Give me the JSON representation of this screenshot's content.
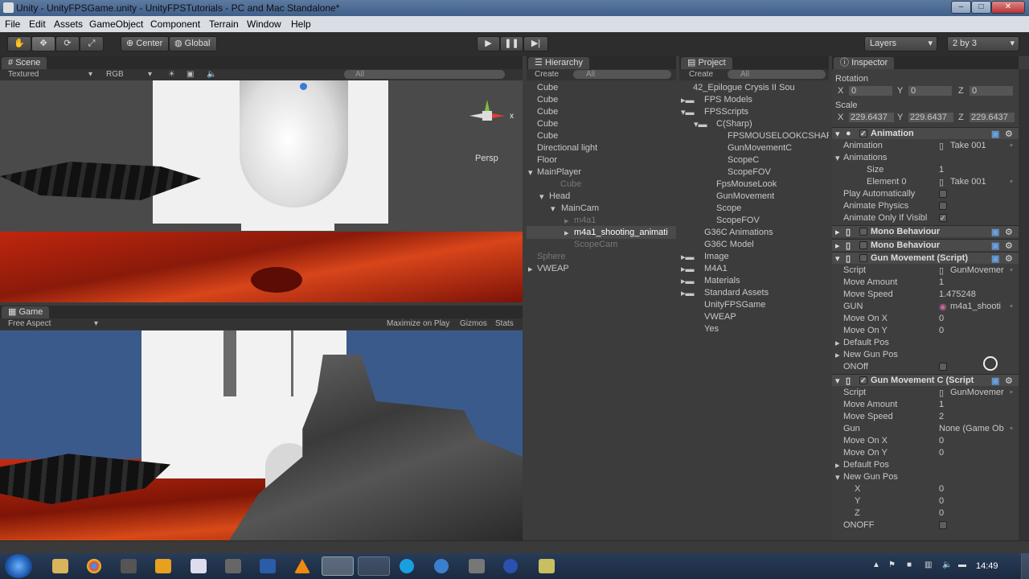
{
  "window": {
    "title": "Unity - UnityFPSGame.unity - UnityFPSTutorials - PC and Mac Standalone*"
  },
  "menu": [
    "File",
    "Edit",
    "Assets",
    "GameObject",
    "Component",
    "Terrain",
    "Window",
    "Help"
  ],
  "toolbar": {
    "center": "Center",
    "global": "Global",
    "layers": "Layers",
    "layout": "2 by 3"
  },
  "scene": {
    "tab": "Scene",
    "mode": "Textured",
    "rgb": "RGB",
    "search": "All",
    "persp": "Persp",
    "x": "x"
  },
  "game": {
    "tab": "Game",
    "aspect": "Free Aspect",
    "maximize": "Maximize on Play",
    "gizmos": "Gizmos",
    "stats": "Stats"
  },
  "hierarchy": {
    "tab": "Hierarchy",
    "create": "Create",
    "search": "All",
    "items": [
      "Cube",
      "Cube",
      "Cube",
      "Cube",
      "Cube",
      "Directional light",
      "Floor",
      "MainPlayer",
      "Cube",
      "Head",
      "MainCam",
      "m4a1",
      "m4a1_shooting_animati",
      "ScopeCam",
      "Sphere",
      "VWEAP"
    ]
  },
  "project": {
    "tab": "Project",
    "create": "Create",
    "search": "All",
    "items": [
      "42_Epilogue  Crysis II  Sou",
      "FPS Models",
      "FPSScripts",
      "C(Sharp)",
      "FPSMOUSELOOKCSHAR",
      "GunMovementC",
      "ScopeC",
      "ScopeFOV",
      "FpsMouseLook",
      "GunMovement",
      "Scope",
      "ScopeFOV",
      "G36C Animations",
      "G36C Model",
      "Image",
      "M4A1",
      "Materials",
      "Standard Assets",
      "UnityFPSGame",
      "VWEAP",
      "Yes"
    ]
  },
  "inspector": {
    "tab": "Inspector",
    "rotation_label": "Rotation",
    "rx": "0",
    "ry": "0",
    "rz": "0",
    "scale_label": "Scale",
    "sx": "229.6437",
    "sy": "229.6437",
    "sz": "229.6437",
    "axis_x": "X",
    "axis_y": "Y",
    "axis_z": "Z",
    "animation": {
      "title": "Animation",
      "anim_label": "Animation",
      "anim_val": "Take 001",
      "anims_label": "Animations",
      "size_label": "Size",
      "size_val": "1",
      "el0_label": "Element 0",
      "el0_val": "Take 001",
      "play_auto": "Play Automatically",
      "animate_physics": "Animate Physics",
      "animate_visible": "Animate Only If Visibl"
    },
    "mono1": "Mono Behaviour",
    "mono2": "Mono Behaviour",
    "gun_movement": {
      "title": "Gun Movement  (Script)",
      "script_label": "Script",
      "script_val": "GunMovemer",
      "move_amount_label": "Move Amount",
      "move_amount_val": "1",
      "move_speed_label": "Move Speed",
      "move_speed_val": "1.475248",
      "gun_label": "GUN",
      "gun_val": "m4a1_shooti",
      "move_x_label": "Move On X",
      "move_x_val": "0",
      "move_y_label": "Move On Y",
      "move_y_val": "0",
      "default_pos": "Default Pos",
      "new_gun_pos": "New Gun Pos",
      "onoff": "ONOff"
    },
    "gun_movement_c": {
      "title": "Gun Movement C (Script",
      "script_label": "Script",
      "script_val": "GunMovemer",
      "move_amount_label": "Move Amount",
      "move_amount_val": "1",
      "move_speed_label": "Move Speed",
      "move_speed_val": "2",
      "gun_label": "Gun",
      "gun_val": "None (Game Ob",
      "move_x_label": "Move On X",
      "move_x_val": "0",
      "move_y_label": "Move On Y",
      "move_y_val": "0",
      "default_pos": "Default Pos",
      "new_gun_pos": "New Gun Pos",
      "x_label": "X",
      "x_val": "0",
      "y_label": "Y",
      "y_val": "0",
      "z_label": "Z",
      "z_val": "0",
      "onoff": "ONOFF"
    }
  },
  "taskbar": {
    "clock": "14:49"
  }
}
